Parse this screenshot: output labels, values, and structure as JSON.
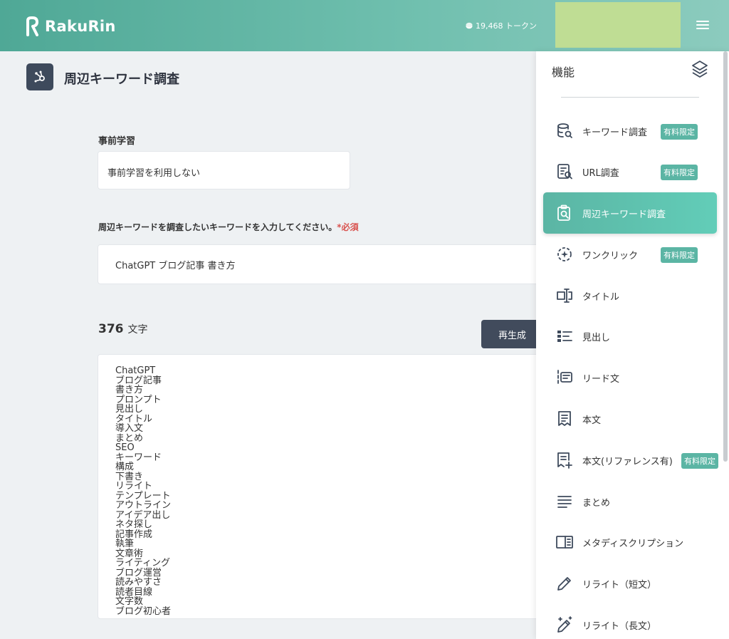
{
  "app": {
    "brand": "RakuRin"
  },
  "header": {
    "tokens": "19,468 トークン"
  },
  "page": {
    "title": "周辺キーワード調査"
  },
  "form": {
    "pretraining_label": "事前学習",
    "pretraining_value": "事前学習を利用しない",
    "keyword_label": "周辺キーワードを調査したいキーワードを入力してください。",
    "required_mark": "*必須",
    "keyword_value": "ChatGPT ブログ記事 書き方",
    "char_count": "376",
    "char_unit": "文字",
    "regenerate_label": "再生成"
  },
  "results": [
    "ChatGPT",
    "ブログ記事",
    "書き方",
    "プロンプト",
    "見出し",
    "タイトル",
    "導入文",
    "まとめ",
    "SEO",
    "キーワード",
    "構成",
    "下書き",
    "リライト",
    "テンプレート",
    "アウトライン",
    "アイデア出し",
    "ネタ探し",
    "記事作成",
    "執筆",
    "文章術",
    "ライティング",
    "ブログ運営",
    "読みやすさ",
    "読者目線",
    "文字数",
    "ブログ初心者"
  ],
  "panel": {
    "title": "機能",
    "paid_badge": "有料限定",
    "items": [
      {
        "label": "キーワード調査",
        "icon": "keyword-search-icon",
        "paid": true
      },
      {
        "label": "URL調査",
        "icon": "url-search-icon",
        "paid": true
      },
      {
        "label": "周辺キーワード調査",
        "icon": "clipboard-search-icon",
        "paid": false,
        "active": true
      },
      {
        "label": "ワンクリック",
        "icon": "one-click-icon",
        "paid": true
      },
      {
        "label": "タイトル",
        "icon": "title-icon",
        "paid": false
      },
      {
        "label": "見出し",
        "icon": "heading-icon",
        "paid": false
      },
      {
        "label": "リード文",
        "icon": "lead-text-icon",
        "paid": false
      },
      {
        "label": "本文",
        "icon": "body-text-icon",
        "paid": false
      },
      {
        "label": "本文(リファレンス有)",
        "icon": "body-reference-icon",
        "paid": true
      },
      {
        "label": "まとめ",
        "icon": "summary-icon",
        "paid": false
      },
      {
        "label": "メタディスクリプション",
        "icon": "meta-description-icon",
        "paid": false
      },
      {
        "label": "リライト（短文）",
        "icon": "pencil-icon",
        "paid": false
      },
      {
        "label": "リライト（長文）",
        "icon": "magic-pencil-icon",
        "paid": false
      }
    ]
  },
  "colors": {
    "accent": "#5bb5a4",
    "dark": "#414b5c",
    "required": "#d9534f"
  }
}
